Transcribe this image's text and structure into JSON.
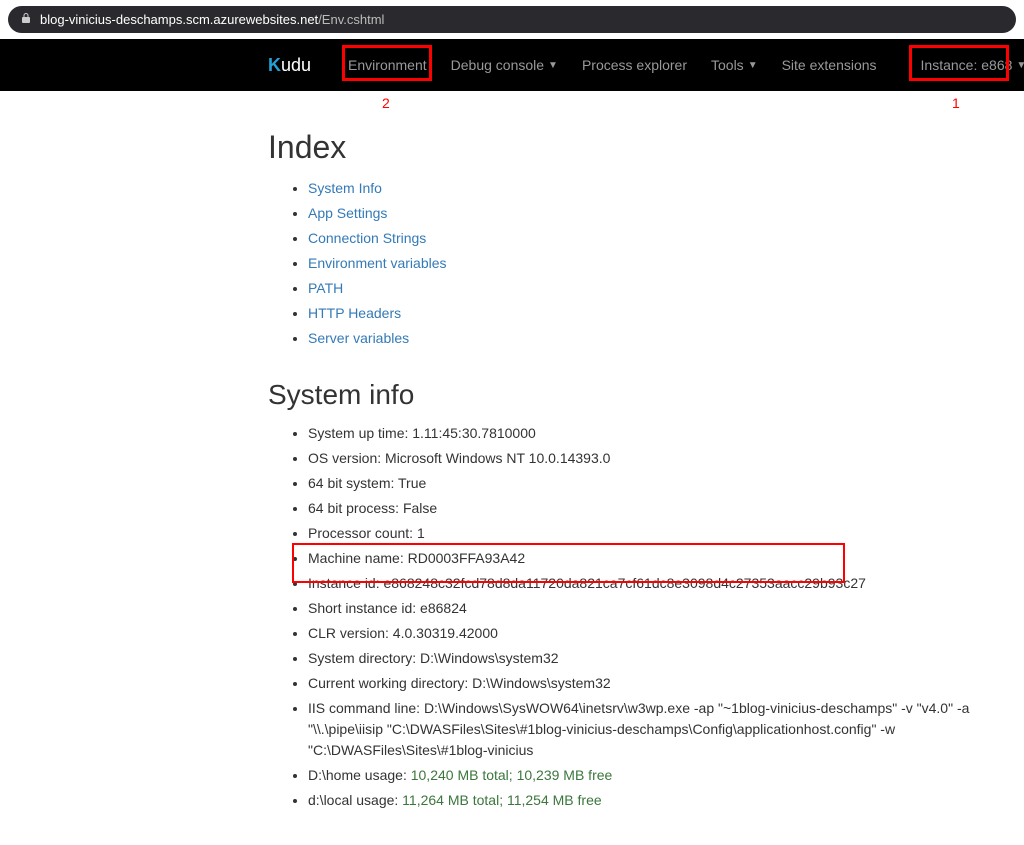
{
  "address": {
    "host": "blog-vinicius-deschamps.scm.azurewebsites.net",
    "path": "/Env.cshtml"
  },
  "brand": "udu",
  "nav": {
    "env": "Environment",
    "debug": "Debug console",
    "process": "Process explorer",
    "tools": "Tools",
    "ext": "Site extensions",
    "instance": "Instance: e868"
  },
  "labels": {
    "l1": "1",
    "l2": "2"
  },
  "index": {
    "title": "Index",
    "items": [
      "System Info",
      "App Settings",
      "Connection Strings",
      "Environment variables",
      "PATH",
      "HTTP Headers",
      "Server variables"
    ]
  },
  "sysinfo": {
    "title": "System info",
    "uptime": "System up time: 1.11:45:30.7810000",
    "os": "OS version: Microsoft Windows NT 10.0.14393.0",
    "bit_system": "64 bit system: True",
    "bit_process": "64 bit process: False",
    "proc_count": "Processor count: 1",
    "machine": "Machine name: RD0003FFA93A42",
    "instance_id": "Instance id: e868248c32fcd78d8da11720da821ca7cf61dc8e3098d4c27353aacc29b93c27",
    "short_instance": "Short instance id: e86824",
    "clr": "CLR version: 4.0.30319.42000",
    "sysdir": "System directory: D:\\Windows\\system32",
    "cwd": "Current working directory: D:\\Windows\\system32",
    "iis_cmd": "IIS command line: D:\\Windows\\SysWOW64\\inetsrv\\w3wp.exe -ap \"~1blog-vinicius-deschamps\" -v \"v4.0\" -a \"\\\\.\\pipe\\iisip \"C:\\DWASFiles\\Sites\\#1blog-vinicius-deschamps\\Config\\applicationhost.config\" -w \"C:\\DWASFiles\\Sites\\#1blog-vinicius",
    "home_prefix": "D:\\home usage: ",
    "home_green": "10,240 MB total; 10,239 MB free",
    "local_prefix": "d:\\local usage: ",
    "local_green": "11,264 MB total; 11,254 MB free"
  }
}
